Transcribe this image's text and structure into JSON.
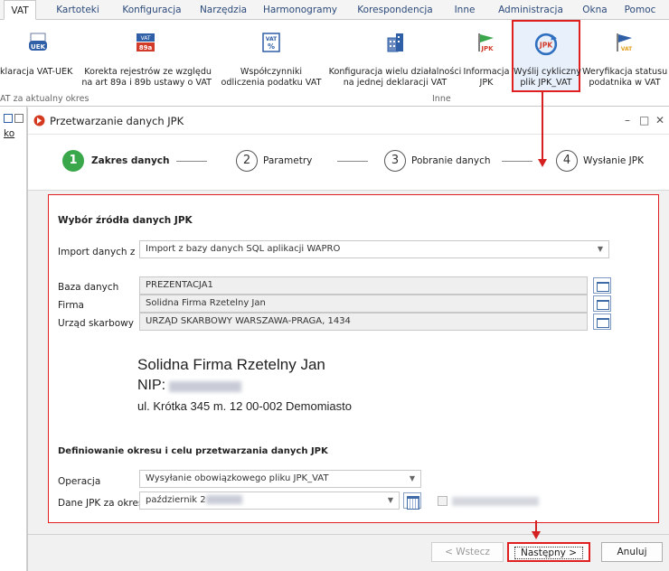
{
  "menu": {
    "items": [
      "VAT",
      "Kartoteki",
      "Konfiguracja",
      "Narzędzia",
      "Harmonogramy",
      "Korespondencja",
      "Inne",
      "Administracja",
      "Okna",
      "Pomoc"
    ],
    "active": "VAT"
  },
  "ribbon": {
    "buttons": [
      {
        "line1": "klaracja VAT-UEK",
        "line2": "",
        "icon": "uek-icon"
      },
      {
        "line1": "Korekta rejestrów ze względu",
        "line2": "na art 89a i 89b ustawy o VAT",
        "icon": "89a-icon"
      },
      {
        "line1": "Współczynniki",
        "line2": "odliczenia podatku VAT",
        "icon": "vat-percent-icon"
      },
      {
        "line1": "Konfiguracja wielu działalności",
        "line2": "na jednej deklaracji VAT",
        "icon": "building-icon"
      },
      {
        "line1": "Informacja",
        "line2": "JPK",
        "icon": "jpk-flag-icon"
      },
      {
        "line1": "Wyślij cykliczny",
        "line2": "plik JPK_VAT",
        "icon": "cyclic-jpk-icon"
      },
      {
        "line1": "Weryfikacja statusu",
        "line2": "podatnika w VAT",
        "icon": "vat-flag-icon"
      }
    ],
    "groups": [
      "AT za aktualny okres",
      "Inne"
    ],
    "icon_texts": {
      "uek": "UEK",
      "a89": "89a",
      "vat": "VAT",
      "pct": "%",
      "jpk": "JPK",
      "vat2": "VAT"
    }
  },
  "leftstrip": {
    "link": "ko"
  },
  "window": {
    "title": "Przetwarzanie danych JPK",
    "controls": {
      "minimize": "–",
      "maximize": "□",
      "close": "✕"
    }
  },
  "steps": [
    {
      "num": "1",
      "label": "Zakres danych",
      "active": true
    },
    {
      "num": "2",
      "label": "Parametry",
      "active": false
    },
    {
      "num": "3",
      "label": "Pobranie danych",
      "active": false
    },
    {
      "num": "4",
      "label": "Wysłanie JPK",
      "active": false
    }
  ],
  "source": {
    "title": "Wybór źródła danych JPK",
    "import_label": "Import danych z",
    "import_value": "Import z bazy danych SQL aplikacji WAPRO",
    "db_label": "Baza danych",
    "db_value": "PREZENTACJA1",
    "firm_label": "Firma",
    "firm_value": "Solidna Firma Rzetelny Jan",
    "office_label": "Urząd skarbowy",
    "office_value": "URZĄD SKARBOWY WARSZAWA-PRAGA, 1434"
  },
  "company": {
    "name": "Solidna Firma Rzetelny Jan",
    "nip_label": "NIP:",
    "address": "ul. Krótka 345 m. 12 00-002 Demomiasto"
  },
  "period": {
    "title": "Definiowanie okresu i celu przetwarzania danych JPK",
    "operation_label": "Operacja",
    "operation_value": "Wysyłanie obowiązkowego pliku JPK_VAT",
    "period_label": "Dane JPK za okres",
    "period_value": "październik 2"
  },
  "footer": {
    "back": "< Wstecz",
    "next": "Następny >",
    "cancel": "Anuluj"
  },
  "colors": {
    "accent_red": "#e02020",
    "step_active": "#3aa84a"
  }
}
